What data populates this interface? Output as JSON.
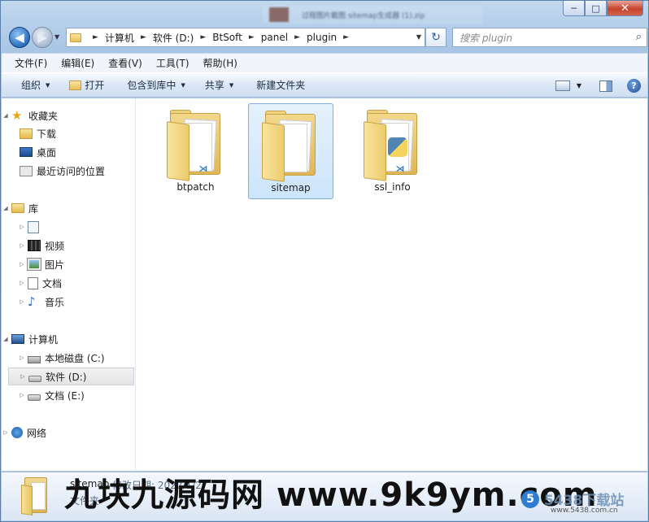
{
  "window": {
    "blurred_title": "过程图片截图 sitemap生成器 (1).zip",
    "minimize": "─",
    "maximize": "□",
    "close": "✕"
  },
  "nav_buttons": {
    "back": "◀",
    "forward": "▶"
  },
  "address": {
    "crumbs": [
      "计算机",
      "软件 (D:)",
      "BtSoft",
      "panel",
      "plugin"
    ],
    "separator": "►",
    "dropdown": "▼"
  },
  "refresh": "↻",
  "search": {
    "placeholder": "搜索 plugin",
    "icon": "⌕"
  },
  "menu": [
    "文件(F)",
    "编辑(E)",
    "查看(V)",
    "工具(T)",
    "帮助(H)"
  ],
  "toolbar": {
    "organize": "组织",
    "open": "打开",
    "include_in_library": "包含到库中",
    "share": "共享",
    "new_folder": "新建文件夹",
    "help": "?"
  },
  "sidebar": {
    "favorites": "收藏夹",
    "downloads": "下载",
    "desktop": "桌面",
    "recent": "最近访问的位置",
    "libraries": "库",
    "lib_blank": "",
    "videos": "视频",
    "pictures": "图片",
    "documents": "文档",
    "music": "音乐",
    "computer": "计算机",
    "drive_c": "本地磁盘 (C:)",
    "drive_d": "软件 (D:)",
    "drive_e": "文档 (E:)",
    "network": "网络"
  },
  "files": [
    {
      "name": "btpatch",
      "selected": false
    },
    {
      "name": "sitemap",
      "selected": true
    },
    {
      "name": "ssl_info",
      "selected": false
    }
  ],
  "details": {
    "name": "sitemap",
    "modified_label": "修改日期: 2022/1/27",
    "type": "文件夹"
  },
  "watermark": {
    "text": "九块九源码网 www.9k9ym.com",
    "logo": "5",
    "site": "5438下载站",
    "url": "www.5438.com.cn"
  },
  "colors": {
    "selection": "#cce5fb",
    "accent": "#2b6fc0"
  }
}
